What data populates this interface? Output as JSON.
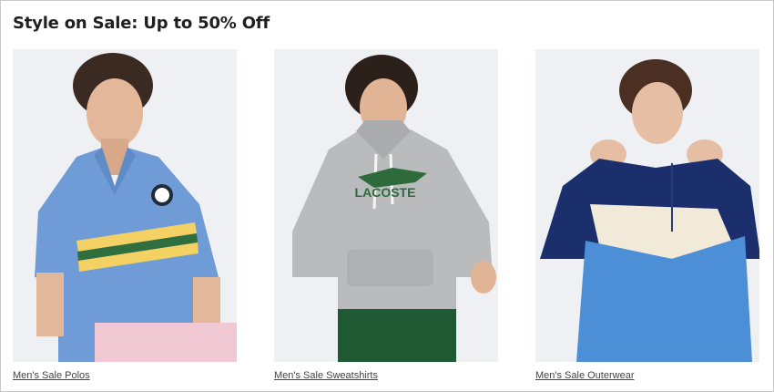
{
  "section": {
    "title": "Style on Sale: Up to 50% Off"
  },
  "cards": [
    {
      "link_label": "Men's Sale Polos",
      "image_alt": "Man wearing a light blue Lacoste polo with yellow and green stripes",
      "colors": {
        "bg": "#eef0f3",
        "garment": "#6f9bd6",
        "stripe1": "#f3d263",
        "stripe2": "#2f6e3f"
      }
    },
    {
      "link_label": "Men's Sale Sweatshirts",
      "image_alt": "Man wearing a grey Lacoste hoodie with green crocodile logo",
      "colors": {
        "bg": "#eef0f3",
        "garment": "#b9bbbd",
        "logo": "#2d6b3a",
        "shorts": "#1f5a35"
      }
    },
    {
      "link_label": "Men's Sale Outerwear",
      "image_alt": "Man wearing a navy, cream and blue colorblock anorak jacket",
      "colors": {
        "bg": "#eef0f3",
        "navy": "#1c2f6d",
        "cream": "#f2ead8",
        "blue": "#4c8fd7"
      }
    }
  ]
}
